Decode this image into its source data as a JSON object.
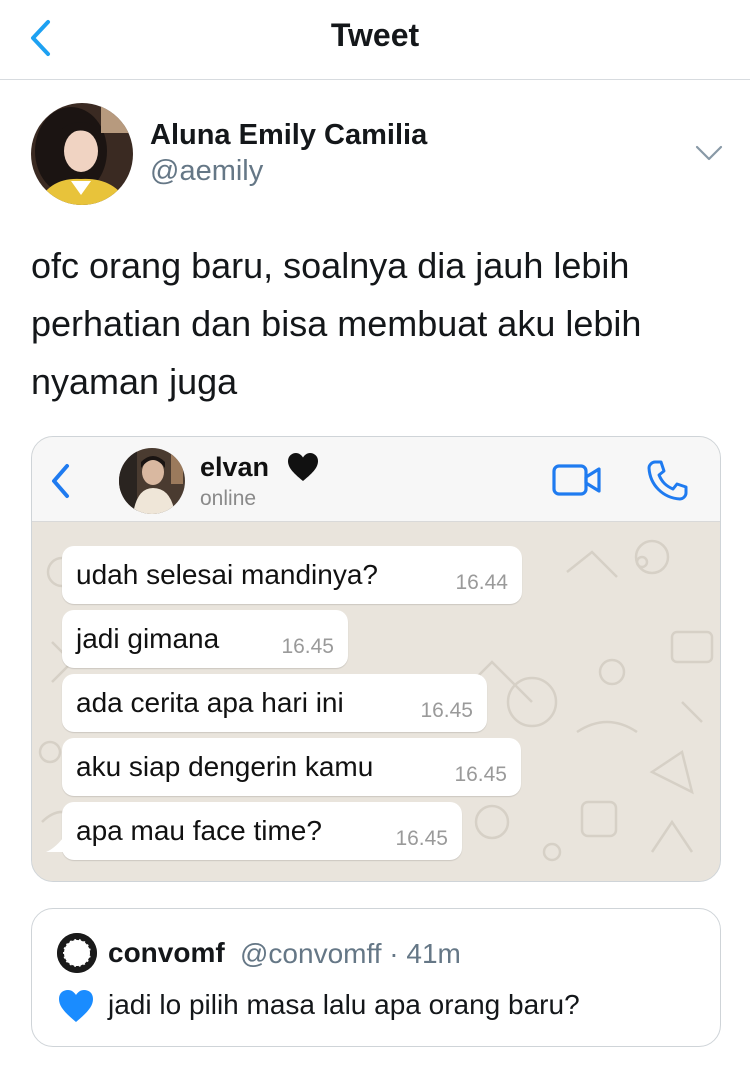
{
  "nav": {
    "title": "Tweet",
    "back_icon": "chevron-left-icon"
  },
  "tweet": {
    "author_name": "Aluna Emily Camilia",
    "author_handle": "@aemily",
    "text": "ofc orang baru, soalnya dia jauh lebih perhatian dan bisa membuat aku lebih nyaman juga"
  },
  "whatsapp": {
    "contact_name": "elvan",
    "contact_status": "online",
    "messages": [
      {
        "text": "udah selesai mandinya?",
        "time": "16.44"
      },
      {
        "text": "jadi gimana",
        "time": "16.45"
      },
      {
        "text": "ada cerita apa hari ini",
        "time": "16.45"
      },
      {
        "text": "aku siap dengerin kamu",
        "time": "16.45"
      },
      {
        "text": "apa mau face time?",
        "time": "16.45"
      }
    ]
  },
  "quoted": {
    "name": "convomf",
    "handle": "@convomff · 41m",
    "text": "jadi lo pilih masa lalu apa orang baru?"
  },
  "colors": {
    "accent": "#1da1f2",
    "whatsapp_blue": "#1f7bf0",
    "muted_text": "#657786",
    "border": "#cfd4d8",
    "chat_background": "#e9e4dc",
    "blue_heart": "#1a8cff"
  }
}
